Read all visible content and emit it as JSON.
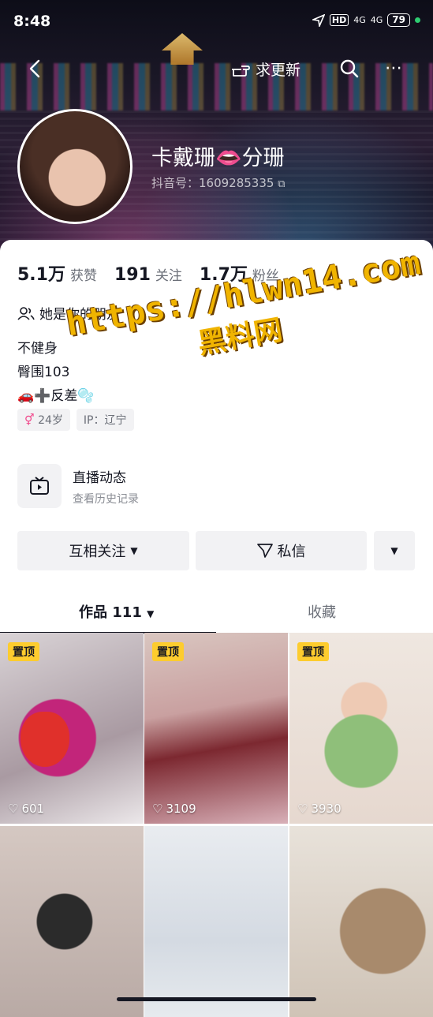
{
  "status": {
    "time": "8:48",
    "network1": "4G",
    "network2": "4G",
    "hd": "HD",
    "battery": "79"
  },
  "header": {
    "request_update_label": "求更新"
  },
  "profile": {
    "name": "卡戴珊👄分珊",
    "douyin_id": "抖音号：1609285335",
    "stats": [
      {
        "value": "5.1万",
        "label": "获赞"
      },
      {
        "value": "191",
        "label": "关注"
      },
      {
        "value": "1.7万",
        "label": "粉丝"
      }
    ],
    "friend_text": "她是你的朋友",
    "bio": [
      "不健身",
      "臀围103",
      "🚗➕反差🫧"
    ],
    "tags": [
      "24岁",
      "IP：辽宁"
    ]
  },
  "watermark": {
    "url": "https://hlwn14.com",
    "name": "黑料网"
  },
  "live": {
    "title": "直播动态",
    "subtitle": "查看历史记录"
  },
  "actions": {
    "mutual": "互相关注",
    "message": "私信"
  },
  "tabs": {
    "works": "作品 111",
    "favorites": "收藏"
  },
  "videos": [
    {
      "pinned": "置顶",
      "likes": "601"
    },
    {
      "pinned": "置顶",
      "likes": "3109"
    },
    {
      "pinned": "置顶",
      "likes": "3930"
    },
    {
      "pinned": "",
      "likes": ""
    },
    {
      "pinned": "",
      "likes": ""
    },
    {
      "pinned": "",
      "likes": ""
    }
  ],
  "colors": {
    "pin": "#fdcc2e",
    "text": "#161823",
    "muted": "#6b6f78"
  }
}
